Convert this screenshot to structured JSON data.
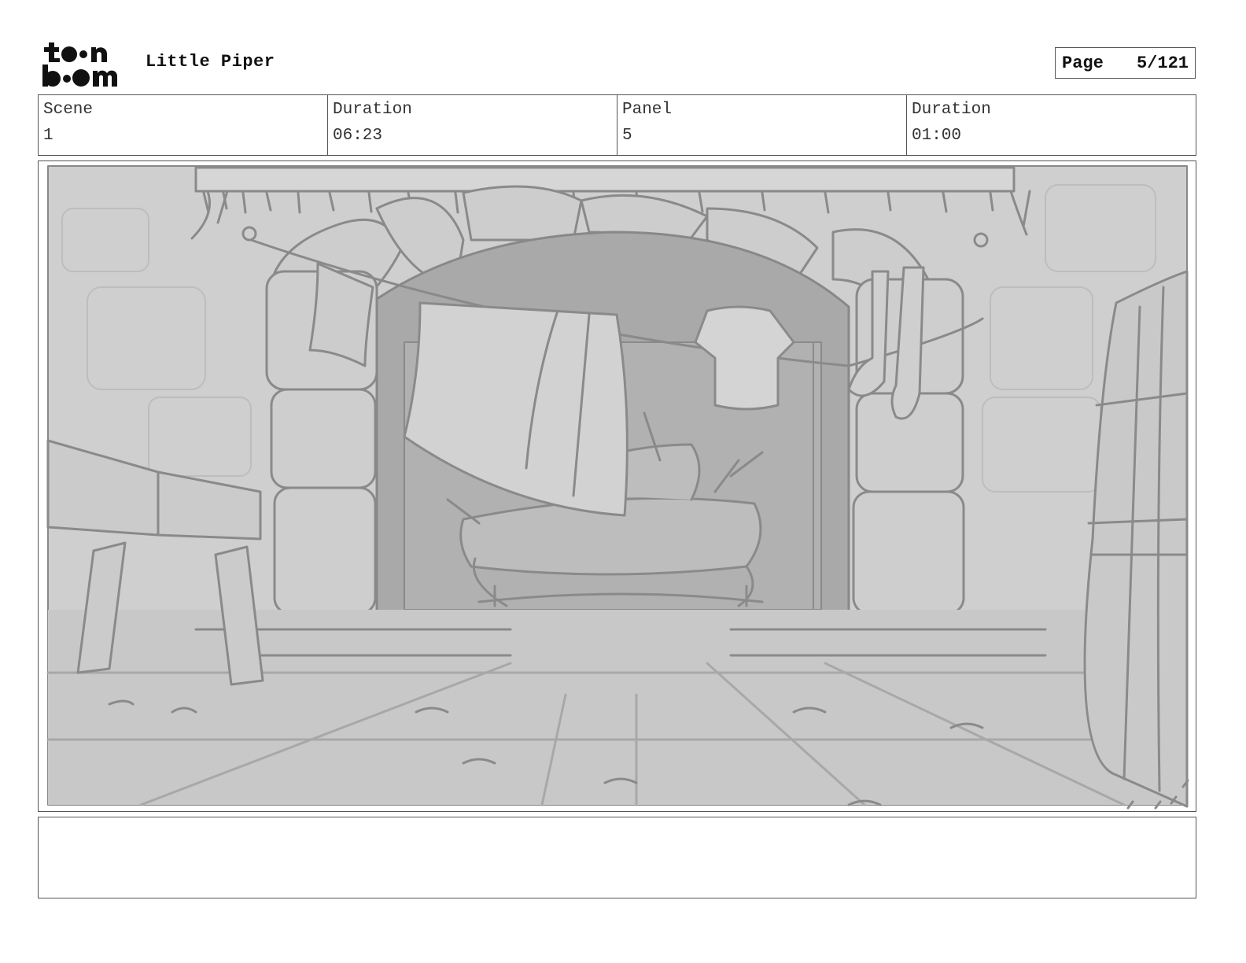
{
  "header": {
    "logo_text_top": "toon",
    "logo_text_bottom": "boom",
    "project_title": "Little Piper",
    "page_label": "Page",
    "page_value": "5/121"
  },
  "info": [
    {
      "label": "Scene",
      "value": "1"
    },
    {
      "label": "Duration",
      "value": "06:23"
    },
    {
      "label": "Panel",
      "value": "5"
    },
    {
      "label": "Duration",
      "value": "01:00"
    }
  ],
  "notes": {
    "text": ""
  }
}
